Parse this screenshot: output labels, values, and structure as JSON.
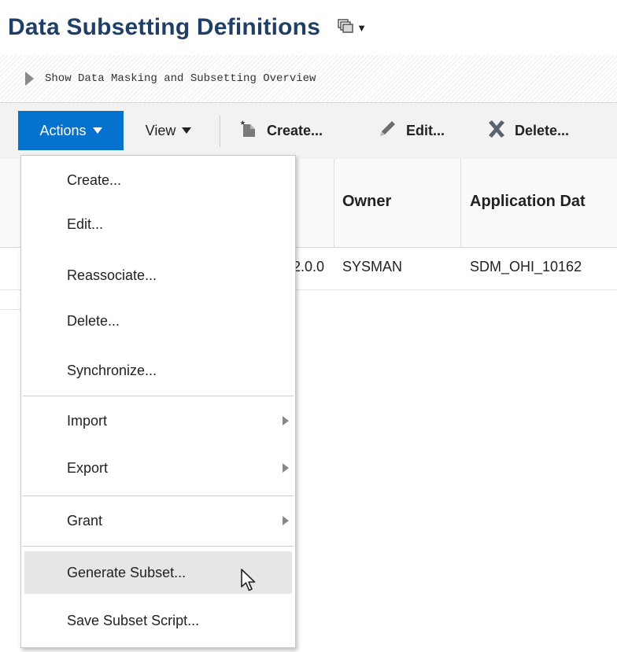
{
  "page": {
    "title": "Data Subsetting Definitions"
  },
  "overview": {
    "label": "Show Data Masking and Subsetting Overview"
  },
  "toolbar": {
    "actions_label": "Actions",
    "view_label": "View",
    "create_label": "Create...",
    "edit_label": "Edit...",
    "delete_label": "Delete..."
  },
  "table": {
    "columns": [
      "Owner",
      "Application Dat"
    ],
    "row": {
      "version_fragment": "2.0.0",
      "owner": "SYSMAN",
      "application_data": "SDM_OHI_10162"
    }
  },
  "menu": {
    "items": [
      {
        "label": "Create..."
      },
      {
        "label": "Edit..."
      },
      {
        "label": "Reassociate..."
      },
      {
        "label": "Delete..."
      },
      {
        "label": "Synchronize..."
      },
      {
        "label": "Import"
      },
      {
        "label": "Export"
      },
      {
        "label": "Grant"
      },
      {
        "label": "Generate Subset..."
      },
      {
        "label": "Save Subset Script..."
      }
    ],
    "highlighted": "Generate Subset..."
  },
  "colors": {
    "accent": "#0572ce",
    "title": "#1f3f66",
    "delete_icon": "#5a6370"
  },
  "icons": [
    "view-options-icon",
    "expand-triangle-icon",
    "create-icon",
    "pencil-icon",
    "delete-x-icon",
    "submenu-arrow-icon",
    "mouse-pointer-icon"
  ]
}
